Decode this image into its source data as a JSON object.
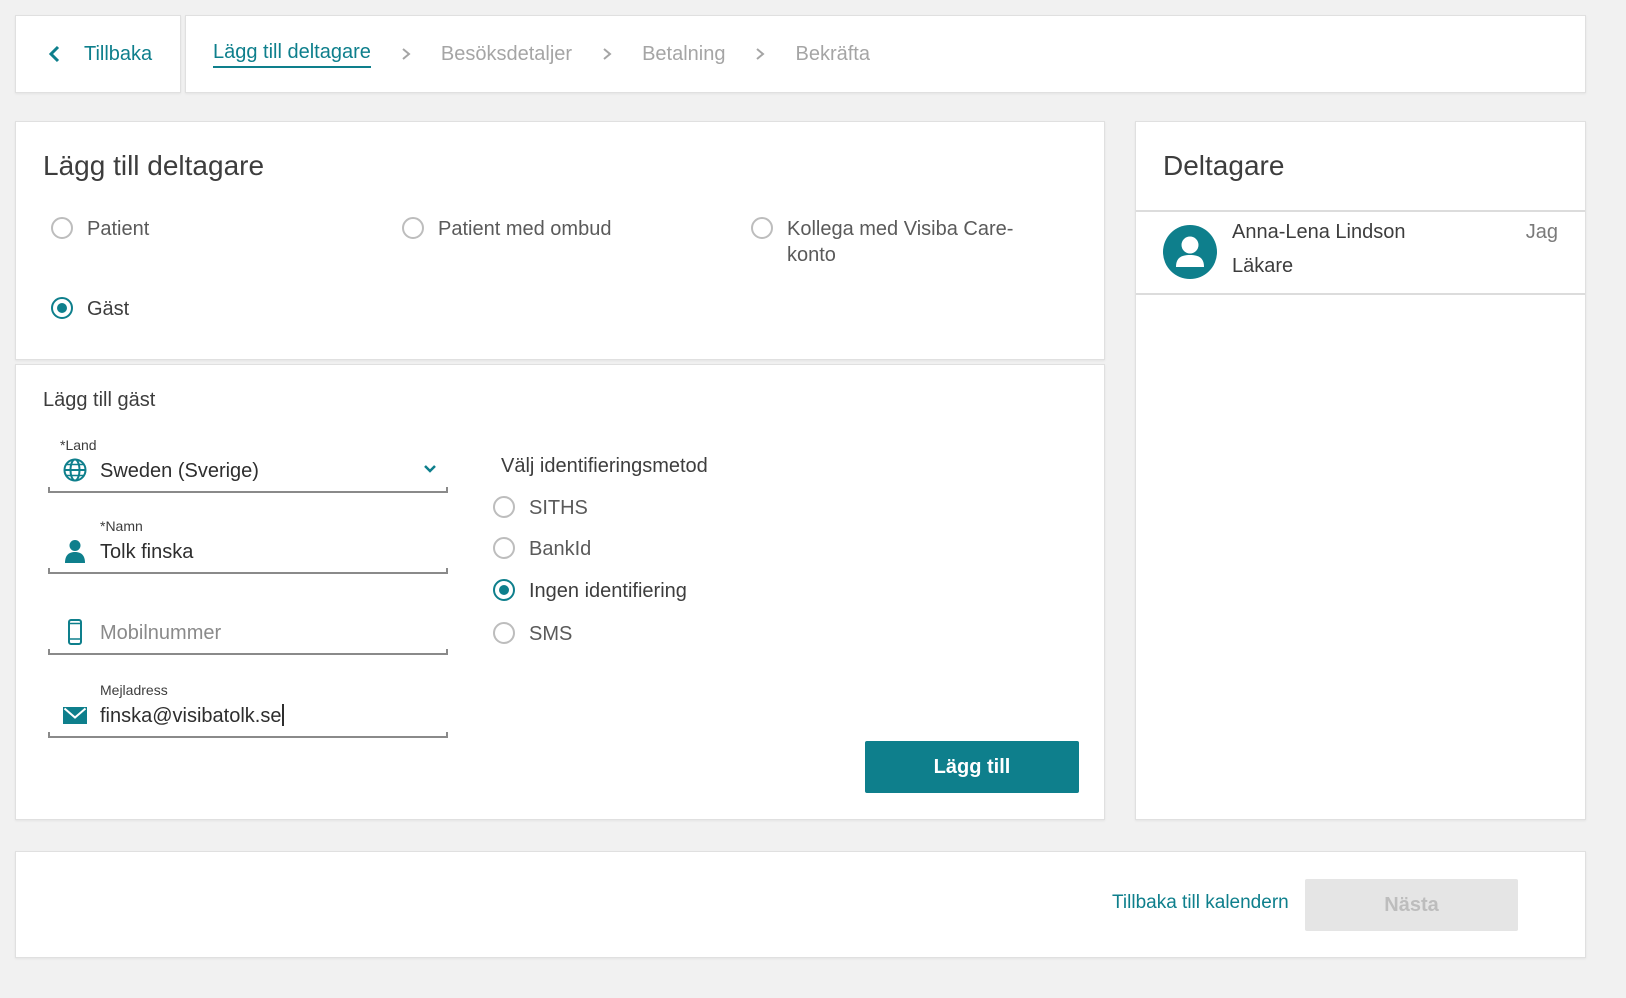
{
  "nav": {
    "back_label": "Tillbaka",
    "steps": [
      {
        "label": "Lägg till deltagare",
        "active": true
      },
      {
        "label": "Besöksdetaljer",
        "active": false
      },
      {
        "label": "Betalning",
        "active": false
      },
      {
        "label": "Bekräfta",
        "active": false
      }
    ]
  },
  "participant_type": {
    "title": "Lägg till deltagare",
    "options": [
      {
        "label": "Patient",
        "selected": false
      },
      {
        "label": "Patient med ombud",
        "selected": false
      },
      {
        "label": "Kollega med Visiba Care-konto",
        "label_line1": "Kollega med Visiba Care-",
        "label_line2": "konto",
        "selected": false
      },
      {
        "label": "Gäst",
        "selected": true
      }
    ]
  },
  "guest": {
    "title": "Lägg till gäst",
    "country": {
      "label": "*Land",
      "value": "Sweden (Sverige)",
      "icon": "globe-icon"
    },
    "name": {
      "label": "*Namn",
      "value": "Tolk finska",
      "icon": "person-icon"
    },
    "phone": {
      "placeholder": "Mobilnummer",
      "icon": "mobile-phone-icon"
    },
    "email": {
      "label": "Mejladress",
      "value": "finska@visibatolk.se",
      "icon": "mail-icon"
    },
    "id_method": {
      "title": "Välj identifieringsmetod",
      "options": [
        {
          "label": "SITHS",
          "selected": false
        },
        {
          "label": "BankId",
          "selected": false
        },
        {
          "label": "Ingen identifiering",
          "selected": true
        },
        {
          "label": "SMS",
          "selected": false
        }
      ]
    },
    "add_label": "Lägg till"
  },
  "participants": {
    "title": "Deltagare",
    "list": [
      {
        "name": "Anna-Lena Lindson",
        "role": "Läkare",
        "tag": "Jag"
      }
    ]
  },
  "footer": {
    "back_to_calendar": "Tillbaka till kalendern",
    "next_label": "Nästa"
  },
  "colors": {
    "accent": "#0e7f8c",
    "disabled_bg": "#e5e5e5",
    "background": "#f1f1f1"
  }
}
